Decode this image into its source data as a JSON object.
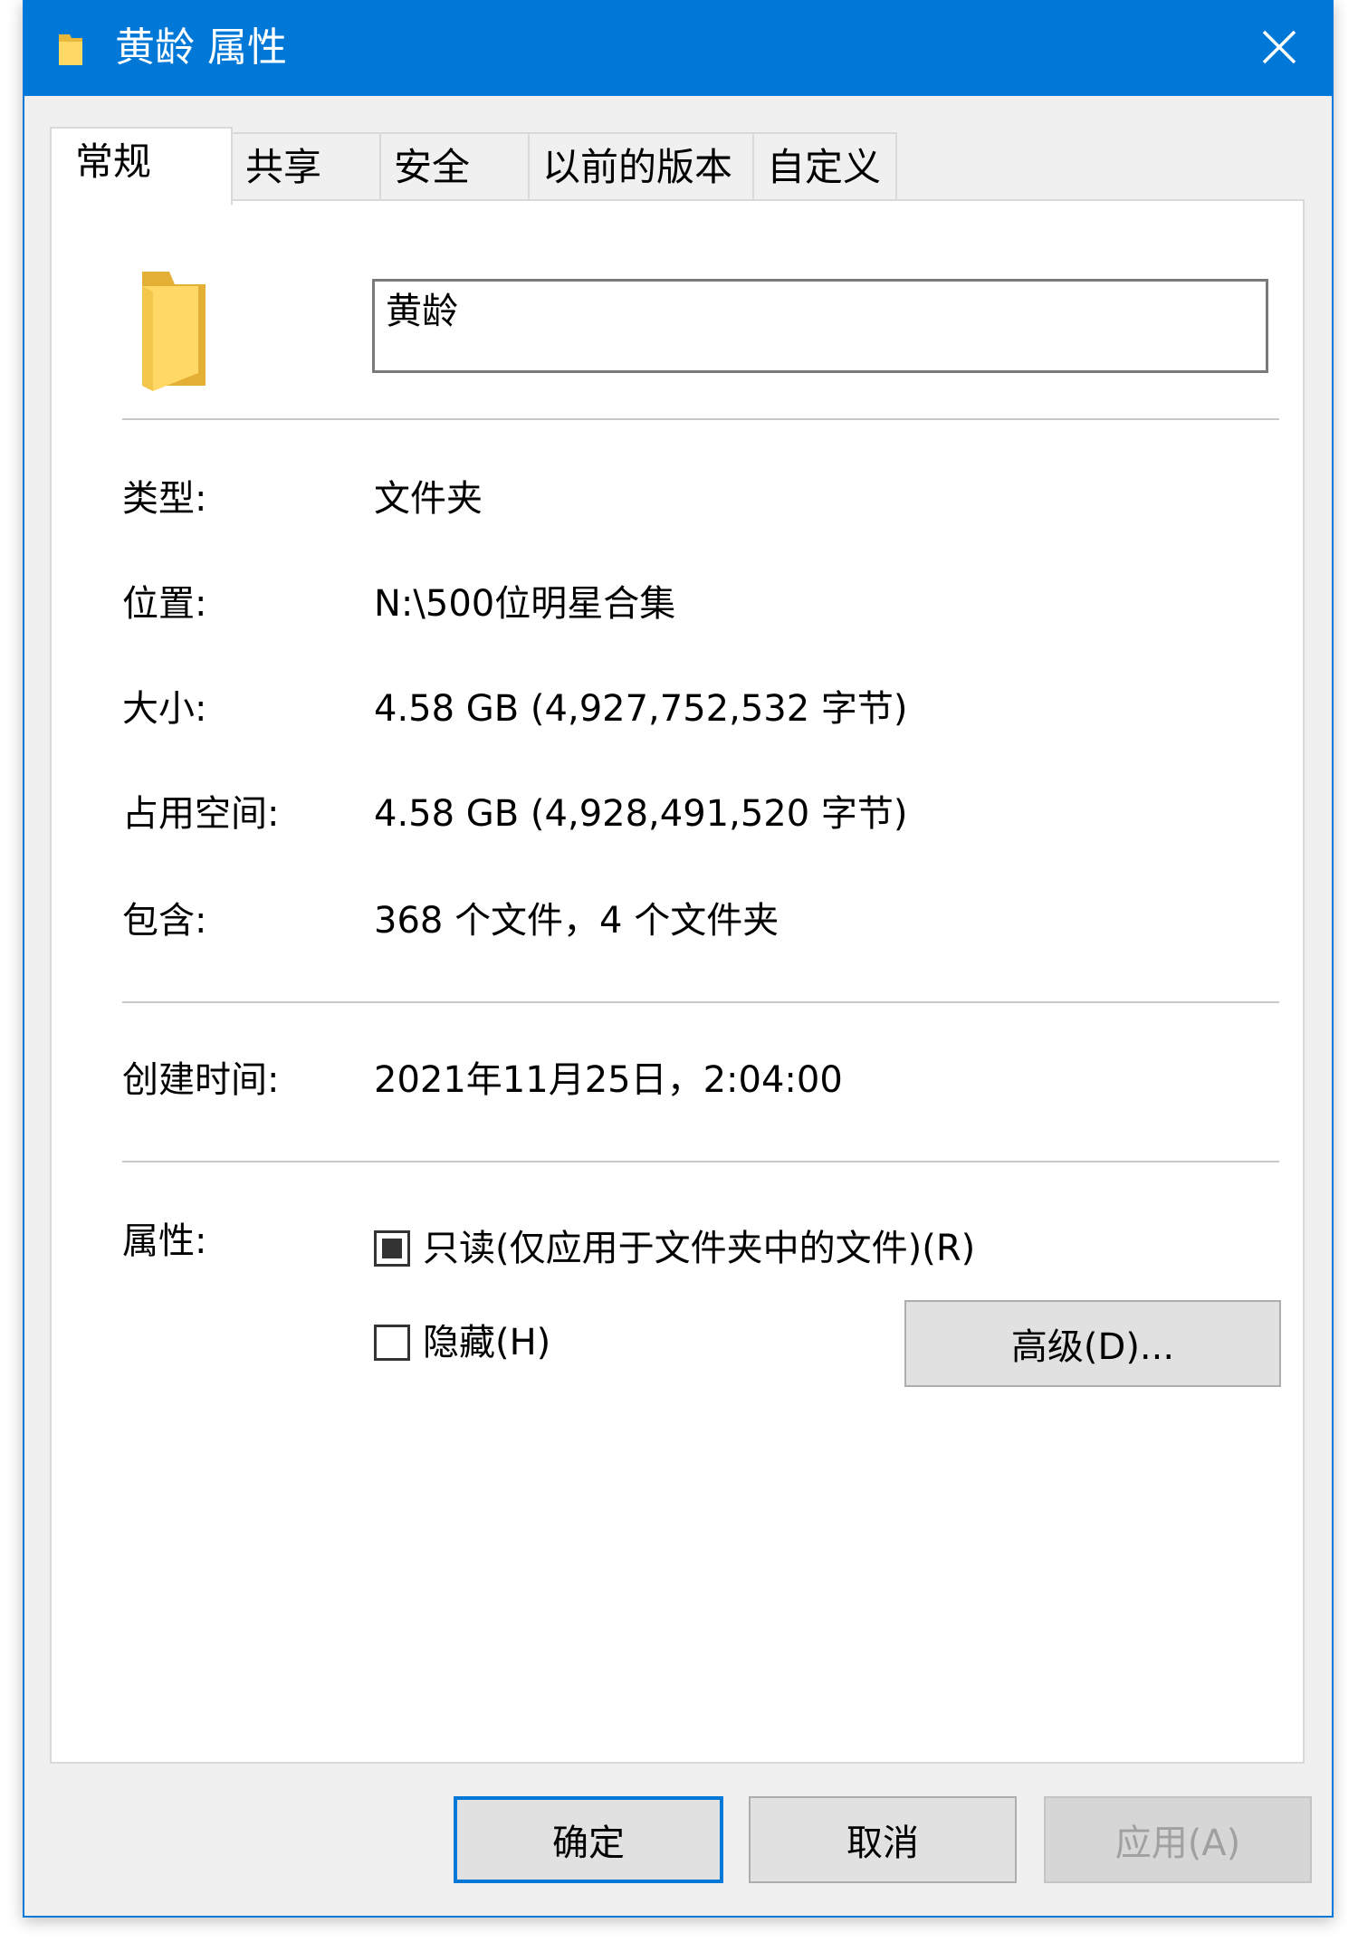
{
  "window": {
    "title": "黄龄 属性",
    "accent": "#0078d7"
  },
  "tabs": [
    {
      "label": "常规",
      "active": true
    },
    {
      "label": "共享"
    },
    {
      "label": "安全"
    },
    {
      "label": "以前的版本"
    },
    {
      "label": "自定义"
    }
  ],
  "general": {
    "name_value": "黄龄",
    "type_label": "类型:",
    "type_value": "文件夹",
    "location_label": "位置:",
    "location_value": "N:\\500位明星合集",
    "size_label": "大小:",
    "size_value": "4.58 GB (4,927,752,532 字节)",
    "size_on_disk_label": "占用空间:",
    "size_on_disk_value": "4.58 GB (4,928,491,520 字节)",
    "contains_label": "包含:",
    "contains_value": "368 个文件，4 个文件夹",
    "created_label": "创建时间:",
    "created_value": "2021年11月25日，2:04:00",
    "attributes_label": "属性:",
    "readonly_label": "只读(仅应用于文件夹中的文件)(R)",
    "readonly_state": "indeterminate",
    "hidden_label": "隐藏(H)",
    "hidden_checked": false,
    "advanced_button": "高级(D)..."
  },
  "footer": {
    "ok": "确定",
    "cancel": "取消",
    "apply": "应用(A)"
  }
}
